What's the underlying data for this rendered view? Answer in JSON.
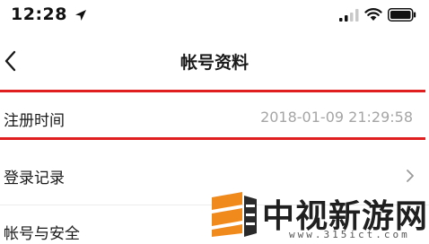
{
  "status_bar": {
    "time": "12:28"
  },
  "nav": {
    "title": "帐号资料"
  },
  "rows": [
    {
      "label": "注册时间",
      "value": "2018-01-09 21:29:58"
    },
    {
      "label": "登录记录"
    },
    {
      "label": "帐号与安全"
    }
  ],
  "watermark": {
    "title": "中视新游网",
    "url": "www.315ict.com"
  },
  "colors": {
    "highlight": "#e02020",
    "value_text": "#a5a5a5",
    "logo_orange": "#f08a1c"
  }
}
